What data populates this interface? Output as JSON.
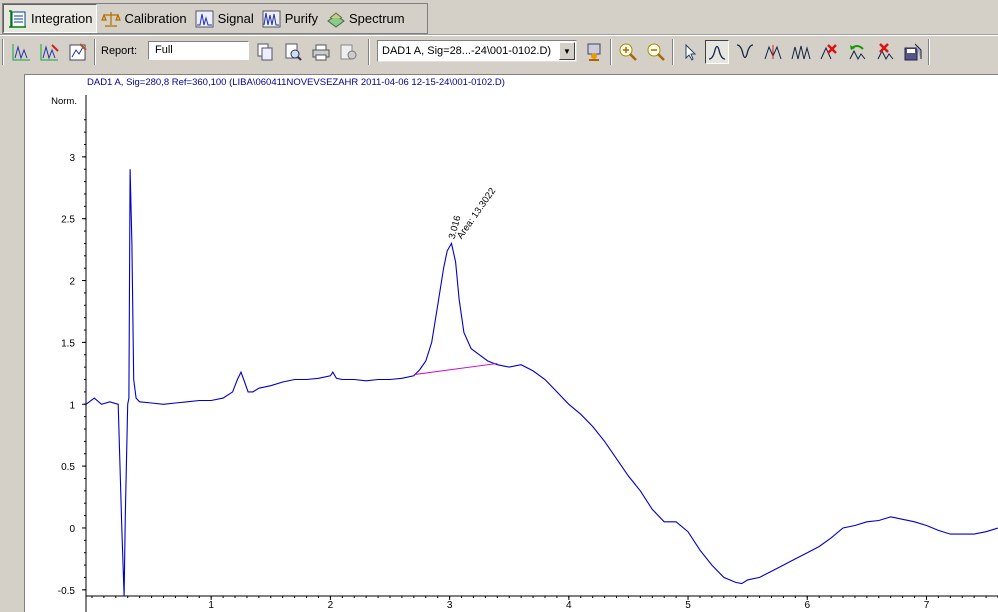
{
  "tabs": [
    {
      "label": "Integration",
      "icon": "integration-icon",
      "active": true
    },
    {
      "label": "Calibration",
      "icon": "scales-icon",
      "active": false
    },
    {
      "label": "Signal",
      "icon": "signal-icon",
      "active": false
    },
    {
      "label": "Purify",
      "icon": "purify-icon",
      "active": false
    },
    {
      "label": "Spectrum",
      "icon": "spectrum-icon",
      "active": false
    }
  ],
  "toolbar": {
    "report_label": "Report:",
    "report_value": "Full",
    "signal_select": "DAD1 A, Sig=28...-24\\001-0102.D)"
  },
  "chart_title": "DAD1 A, Sig=280,8 Ref=360,100 (LIBA\\060411NOVEVSEZAHR 2011-04-06 12-15-24\\001-0102.D)",
  "colors": {
    "trace": "#0000cc",
    "baseline": "#d000d0",
    "title": "#0000a0"
  },
  "chart_data": {
    "type": "line",
    "ylabel": "Norm.",
    "xlabel": "",
    "xlim": [
      -0.05,
      7.6
    ],
    "ylim": [
      -0.55,
      3.5
    ],
    "x_ticks": [
      "1",
      "2",
      "3",
      "4",
      "5",
      "6",
      "7"
    ],
    "y_ticks": [
      "-0.5",
      "0",
      "0.5",
      "1",
      "1.5",
      "2",
      "2.5",
      "3"
    ],
    "series": [
      {
        "x": [
          -0.05,
          0.02,
          0.08,
          0.15,
          0.22,
          0.25,
          0.27,
          0.28,
          0.3,
          0.31,
          0.32,
          0.335,
          0.35,
          0.37,
          0.4,
          0.5,
          0.6,
          0.7,
          0.8,
          0.9,
          1.0,
          1.1,
          1.18,
          1.22,
          1.25,
          1.28,
          1.31,
          1.35,
          1.4,
          1.5,
          1.6,
          1.7,
          1.8,
          1.9,
          2.0,
          2.02,
          2.05,
          2.1,
          2.2,
          2.3,
          2.4,
          2.5,
          2.6,
          2.7,
          2.75,
          2.8,
          2.85,
          2.9,
          2.95,
          2.98,
          3.016,
          3.05,
          3.08,
          3.12,
          3.18,
          3.25,
          3.32,
          3.4,
          3.45,
          3.5,
          3.6,
          3.7,
          3.8,
          3.9,
          4.0,
          4.1,
          4.2,
          4.3,
          4.4,
          4.5,
          4.6,
          4.7,
          4.8,
          4.9,
          5.0,
          5.1,
          5.2,
          5.3,
          5.4,
          5.45,
          5.5,
          5.6,
          5.7,
          5.8,
          5.9,
          6.0,
          6.1,
          6.2,
          6.3,
          6.4,
          6.5,
          6.6,
          6.7,
          6.8,
          6.9,
          7.0,
          7.1,
          7.2,
          7.3,
          7.4,
          7.5,
          7.6
        ],
        "y": [
          1.0,
          1.05,
          1.0,
          1.02,
          1.0,
          0.0,
          -0.55,
          0.1,
          1.0,
          1.05,
          2.9,
          2.3,
          1.2,
          1.05,
          1.02,
          1.01,
          1.0,
          1.01,
          1.02,
          1.03,
          1.03,
          1.05,
          1.1,
          1.2,
          1.26,
          1.18,
          1.1,
          1.1,
          1.13,
          1.15,
          1.18,
          1.2,
          1.2,
          1.21,
          1.23,
          1.26,
          1.21,
          1.2,
          1.2,
          1.19,
          1.2,
          1.2,
          1.21,
          1.23,
          1.28,
          1.35,
          1.5,
          1.8,
          2.1,
          2.24,
          2.3,
          2.15,
          1.85,
          1.58,
          1.45,
          1.4,
          1.35,
          1.32,
          1.31,
          1.3,
          1.32,
          1.27,
          1.2,
          1.1,
          1.0,
          0.92,
          0.82,
          0.7,
          0.56,
          0.42,
          0.3,
          0.15,
          0.05,
          0.05,
          -0.03,
          -0.18,
          -0.3,
          -0.4,
          -0.44,
          -0.45,
          -0.42,
          -0.4,
          -0.35,
          -0.3,
          -0.25,
          -0.2,
          -0.15,
          -0.08,
          0.0,
          0.02,
          0.05,
          0.06,
          0.09,
          0.07,
          0.05,
          0.02,
          -0.02,
          -0.05,
          -0.05,
          -0.05,
          -0.03,
          0.0
        ]
      }
    ],
    "baseline": {
      "x": [
        2.7,
        3.4
      ],
      "y": [
        1.24,
        1.33
      ]
    },
    "annotations": [
      {
        "text": "3.016",
        "x": 3.016,
        "y": 2.3
      },
      {
        "text": "Area: 13.3022",
        "x": 3.016,
        "y": 2.3
      }
    ]
  }
}
